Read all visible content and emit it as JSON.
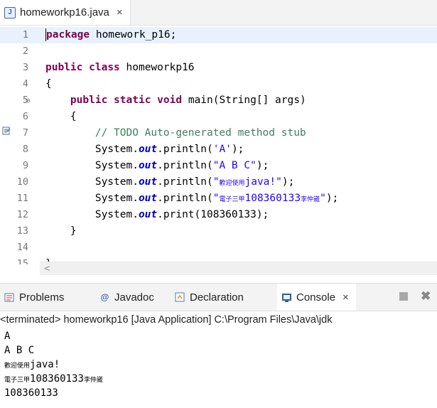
{
  "editor": {
    "tab": {
      "title": "homeworkp16.java",
      "close": "×"
    },
    "lines": [
      {
        "n": "1",
        "parts": [
          {
            "t": "package",
            "c": "kw"
          },
          {
            "t": " homework_p16;",
            "c": ""
          }
        ]
      },
      {
        "n": "2",
        "parts": []
      },
      {
        "n": "3",
        "parts": [
          {
            "t": "public",
            "c": "kw"
          },
          {
            "t": " ",
            "c": ""
          },
          {
            "t": "class",
            "c": "kw"
          },
          {
            "t": " homeworkp16",
            "c": ""
          }
        ]
      },
      {
        "n": "4",
        "parts": [
          {
            "t": "{",
            "c": ""
          }
        ]
      },
      {
        "n": "5",
        "fold": "⊖",
        "parts": [
          {
            "t": "    ",
            "c": ""
          },
          {
            "t": "public",
            "c": "kw"
          },
          {
            "t": " ",
            "c": ""
          },
          {
            "t": "static",
            "c": "kw"
          },
          {
            "t": " ",
            "c": ""
          },
          {
            "t": "void",
            "c": "kw"
          },
          {
            "t": " main(String[] args)",
            "c": ""
          }
        ]
      },
      {
        "n": "6",
        "parts": [
          {
            "t": "    {",
            "c": ""
          }
        ]
      },
      {
        "n": "7",
        "parts": [
          {
            "t": "        // TODO Auto-generated method stub",
            "c": "cm"
          }
        ]
      },
      {
        "n": "8",
        "parts": [
          {
            "t": "        System.",
            "c": ""
          },
          {
            "t": "out",
            "c": "fld"
          },
          {
            "t": ".println(",
            "c": ""
          },
          {
            "t": "'A'",
            "c": "st"
          },
          {
            "t": ");",
            "c": ""
          }
        ]
      },
      {
        "n": "9",
        "parts": [
          {
            "t": "        System.",
            "c": ""
          },
          {
            "t": "out",
            "c": "fld"
          },
          {
            "t": ".println(",
            "c": ""
          },
          {
            "t": "\"A B C\"",
            "c": "st"
          },
          {
            "t": ");",
            "c": ""
          }
        ]
      },
      {
        "n": "10",
        "parts": [
          {
            "t": "        System.",
            "c": ""
          },
          {
            "t": "out",
            "c": "fld"
          },
          {
            "t": ".println(",
            "c": ""
          },
          {
            "t": "\"",
            "c": "st"
          },
          {
            "t": "歡迎使用",
            "c": "cjk"
          },
          {
            "t": "java!\"",
            "c": "st"
          },
          {
            "t": ");",
            "c": ""
          }
        ]
      },
      {
        "n": "11",
        "parts": [
          {
            "t": "        System.",
            "c": ""
          },
          {
            "t": "out",
            "c": "fld"
          },
          {
            "t": ".println(",
            "c": ""
          },
          {
            "t": "\"",
            "c": "st"
          },
          {
            "t": "電子三甲",
            "c": "cjk"
          },
          {
            "t": "108360133",
            "c": "st"
          },
          {
            "t": "李仲崴",
            "c": "cjk"
          },
          {
            "t": "\"",
            "c": "st"
          },
          {
            "t": ");",
            "c": ""
          }
        ]
      },
      {
        "n": "12",
        "parts": [
          {
            "t": "        System.",
            "c": ""
          },
          {
            "t": "out",
            "c": "fld"
          },
          {
            "t": ".print(108360133);",
            "c": ""
          }
        ]
      },
      {
        "n": "13",
        "parts": [
          {
            "t": "    }",
            "c": ""
          }
        ]
      },
      {
        "n": "14",
        "parts": []
      },
      {
        "n": "15",
        "parts": [
          {
            "t": "}",
            "c": ""
          }
        ]
      }
    ],
    "scroll_left": "<"
  },
  "panel": {
    "tabs": [
      {
        "label": "Problems",
        "icon": "problems-icon"
      },
      {
        "label": "Javadoc",
        "icon": "javadoc-icon"
      },
      {
        "label": "Declaration",
        "icon": "declaration-icon"
      },
      {
        "label": "Console",
        "icon": "console-icon"
      }
    ],
    "close": "×",
    "status": "<terminated> homeworkp16 [Java Application] C:\\Program Files\\Java\\jdk",
    "output": [
      {
        "parts": [
          {
            "t": "A",
            "c": ""
          }
        ]
      },
      {
        "parts": [
          {
            "t": "A B C",
            "c": ""
          }
        ]
      },
      {
        "parts": [
          {
            "t": "歡迎使用",
            "c": "cjk2"
          },
          {
            "t": "java!",
            "c": ""
          }
        ]
      },
      {
        "parts": [
          {
            "t": "電子三甲",
            "c": "cjk2"
          },
          {
            "t": "108360133",
            "c": ""
          },
          {
            "t": "李仲崴",
            "c": "cjk2"
          }
        ]
      },
      {
        "parts": [
          {
            "t": "108360133",
            "c": ""
          }
        ]
      }
    ]
  }
}
